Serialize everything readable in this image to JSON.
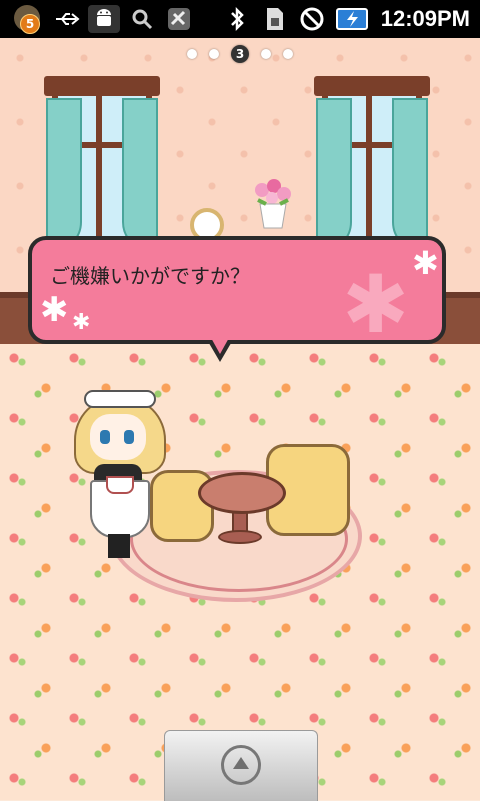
{
  "status_bar": {
    "notification_count": "5",
    "time": "12:09PM",
    "icons": [
      "notification-badge-icon",
      "usb-icon",
      "android-debug-icon",
      "search-icon",
      "satellite-icon",
      "bluetooth-icon",
      "sim-icon",
      "no-signal-icon",
      "battery-charging-icon"
    ]
  },
  "pager": {
    "current_page": "3",
    "total_pages": 5
  },
  "speech_bubble": {
    "text": "ご機嫌いかがですか？"
  },
  "colors": {
    "bubble": "#f47c9b",
    "wall": "#fbd7c4",
    "floor": "#fde3cf",
    "curtain": "#85d0c8"
  },
  "dock": {
    "icon": "launcher-up-arrow-icon"
  }
}
